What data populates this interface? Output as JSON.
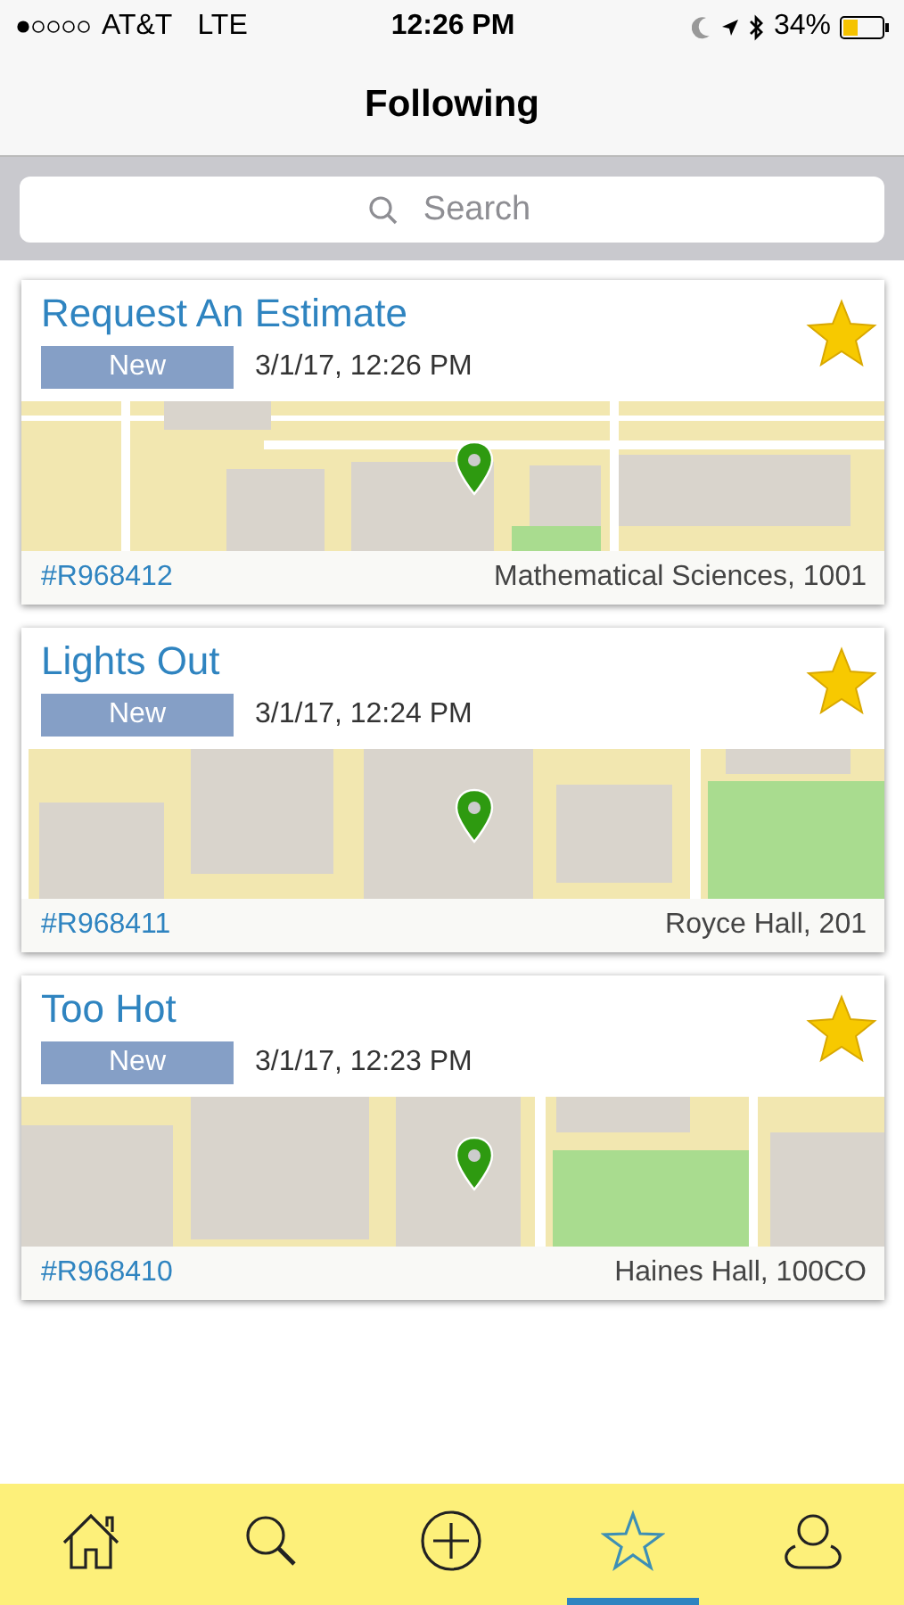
{
  "status_bar": {
    "carrier": "AT&T",
    "network": "LTE",
    "time": "12:26 PM",
    "battery": "34%"
  },
  "nav": {
    "title": "Following"
  },
  "search": {
    "placeholder": "Search"
  },
  "cards": [
    {
      "title": "Request An Estimate",
      "status": "New",
      "date": "3/1/17, 12:26 PM",
      "followed": true,
      "number": "#R968412",
      "location": "Mathematical Sciences, 1001",
      "kind": "picture"
    },
    {
      "title": "Lights Out",
      "status": "New",
      "date": "3/1/17, 12:24 PM",
      "followed": true,
      "number": "#R968411",
      "location": "Royce Hall, 201",
      "kind": "picture"
    },
    {
      "title": "Too Hot",
      "status": "New",
      "date": "3/1/17, 12:23 PM",
      "followed": true,
      "number": "#R968410",
      "location": "Haines Hall, 100CO",
      "kind": "picture"
    }
  ],
  "tabs": [
    {
      "kind": "home",
      "selected": false
    },
    {
      "kind": "search",
      "selected": false
    },
    {
      "kind": "add",
      "selected": false
    },
    {
      "kind": "star",
      "selected": true
    },
    {
      "kind": "profile",
      "selected": false
    }
  ]
}
